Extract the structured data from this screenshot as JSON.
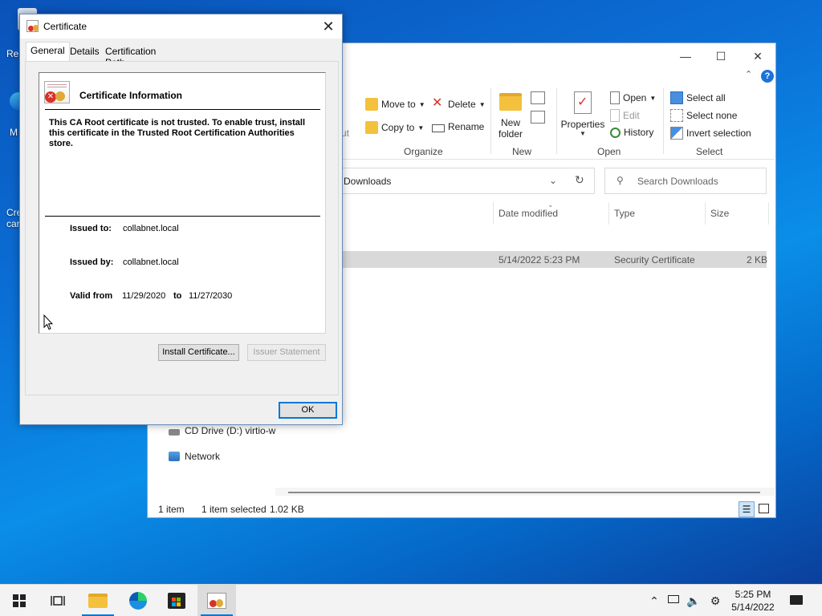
{
  "desktop": {
    "icon_labels": [
      "Re",
      "M",
      "Cre",
      "car"
    ]
  },
  "explorer": {
    "ribbon": {
      "organize": {
        "label": "Organize",
        "move_to": "Move to",
        "copy_to": "Copy to",
        "delete": "Delete",
        "rename": "Rename",
        "cut_partial": "ut"
      },
      "new": {
        "label": "New",
        "new_folder_line1": "New",
        "new_folder_line2": "folder"
      },
      "open": {
        "label": "Open",
        "properties": "Properties",
        "open": "Open",
        "edit": "Edit",
        "history": "History"
      },
      "select": {
        "label": "Select",
        "select_all": "Select all",
        "select_none": "Select none",
        "invert_selection": "Invert selection"
      }
    },
    "address": "Downloads",
    "search_placeholder": "Search Downloads",
    "columns": [
      "Date modified",
      "Type",
      "Size"
    ],
    "file_row": {
      "date": "5/14/2022 5:23 PM",
      "type": "Security Certificate",
      "size": "2 KB"
    },
    "nav": {
      "cd_drive": "CD Drive (D:) virtio-w",
      "network": "Network"
    },
    "status": {
      "items": "1 item",
      "selected": "1 item selected",
      "size": "1.02 KB"
    }
  },
  "certificate": {
    "title": "Certificate",
    "tabs": [
      "General",
      "Details",
      "Certification Path"
    ],
    "info_title": "Certificate Information",
    "warning": "This CA Root certificate is not trusted. To enable trust, install this certificate in the Trusted Root Certification Authorities store.",
    "issued_to_label": "Issued to:",
    "issued_to": "collabnet.local",
    "issued_by_label": "Issued by:",
    "issued_by": "collabnet.local",
    "valid_from_label": "Valid from",
    "valid_from": "11/29/2020",
    "to_label": "to",
    "valid_to": "11/27/2030",
    "install_button": "Install Certificate...",
    "issuer_statement_button": "Issuer Statement",
    "ok_button": "OK"
  },
  "taskbar": {
    "time": "5:25 PM",
    "date": "5/14/2022"
  },
  "colors": {
    "accent": "#0078d7",
    "folder_yellow": "#f4c13d",
    "error_red": "#d8312a"
  }
}
